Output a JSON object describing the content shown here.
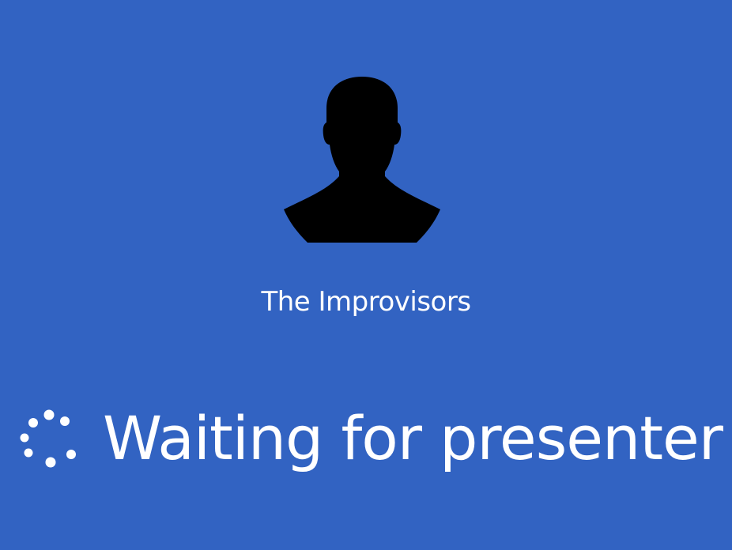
{
  "presenter": {
    "name": "The Improvisors",
    "avatar_icon": "person-silhouette-icon"
  },
  "status": {
    "message": "Waiting for presenter",
    "spinner_icon": "loading-spinner-icon"
  },
  "colors": {
    "background": "#3263c2",
    "text": "#ffffff",
    "avatar": "#000000"
  }
}
